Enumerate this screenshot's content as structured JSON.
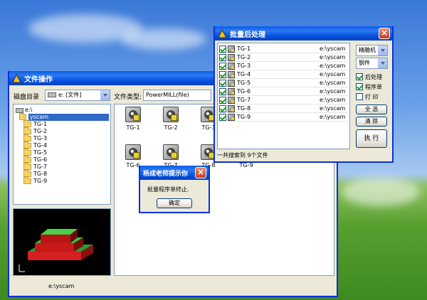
{
  "file_window": {
    "title": "文件操作",
    "drive_label": "磁盘目录",
    "drive_value": "e: [文件]",
    "filetype_label": "文件类型:",
    "filetype_value": "PowerMILL(file)",
    "tree": [
      "e:\\",
      "yscam",
      "TG-1",
      "TG-2",
      "TG-3",
      "TG-4",
      "TG-5",
      "TG-6",
      "TG-7",
      "TG-8",
      "TG-9"
    ],
    "files": [
      "TG-1",
      "TG-2",
      "TG-3",
      "TG-6",
      "TG-7",
      "TG-8",
      "TG-9"
    ],
    "status_path": "e:\\yscam"
  },
  "batch_window": {
    "title": "批量后处理",
    "rows": [
      {
        "name": "TG-1",
        "path": "e:\\yscam"
      },
      {
        "name": "TG-2",
        "path": "e:\\yscam"
      },
      {
        "name": "TG-3",
        "path": "e:\\yscam"
      },
      {
        "name": "TG-4",
        "path": "e:\\yscam"
      },
      {
        "name": "TG-5",
        "path": "e:\\yscam"
      },
      {
        "name": "TG-6",
        "path": "e:\\yscam"
      },
      {
        "name": "TG-7",
        "path": "e:\\yscam"
      },
      {
        "name": "TG-8",
        "path": "e:\\yscam"
      },
      {
        "name": "TG-9",
        "path": "e:\\yscam"
      }
    ],
    "machine_value": "精雕机",
    "material_value": "钢件",
    "opt_post": "后处理",
    "opt_sheet": "程序单",
    "opt_print": "打 印",
    "btn_select_all": "全 选",
    "btn_clear": "清 除",
    "btn_execute": "执 行",
    "status": "一共搜索到   9个文件"
  },
  "message_box": {
    "title": "杨成老师提示你",
    "text": "批量程序单终止.",
    "ok_label": "确定"
  }
}
